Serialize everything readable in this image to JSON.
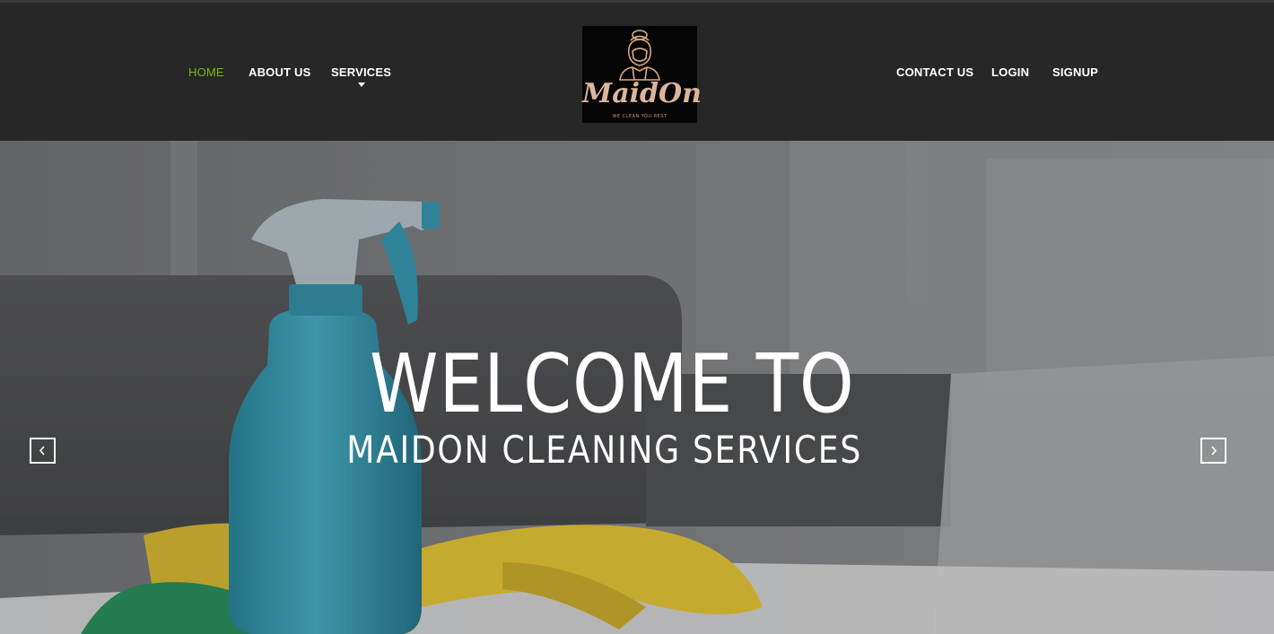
{
  "header": {
    "nav_left": [
      {
        "label": "HOME",
        "active": true
      },
      {
        "label": "ABOUT US",
        "active": false
      },
      {
        "label": "SERVICES",
        "active": false,
        "has_dropdown": true
      }
    ],
    "nav_right": [
      {
        "label": "CONTACT US"
      },
      {
        "label": "LOGIN"
      },
      {
        "label": "SIGNUP"
      }
    ],
    "logo": {
      "wordmark": "MaidOn",
      "tagline": "WE CLEAN YOU REST"
    }
  },
  "hero": {
    "title": "WELCOME TO",
    "subtitle": "MAIDON CLEANING SERVICES",
    "prev_icon": "chevron-left-icon",
    "next_icon": "chevron-right-icon"
  },
  "colors": {
    "header_bg": "#272727",
    "nav_active": "#7cb518",
    "nav_text": "#ffffff",
    "logo_accent": "#dbb59c"
  }
}
